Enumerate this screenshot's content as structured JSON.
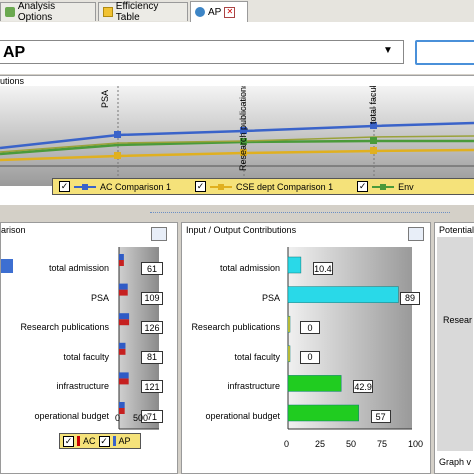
{
  "tabs": [
    {
      "label": "Analysis Options",
      "active": false
    },
    {
      "label": "Efficiency Table",
      "active": false
    },
    {
      "label": "AP",
      "active": true,
      "closable": true
    }
  ],
  "unit_select": {
    "value": "AP"
  },
  "contributions_panel": {
    "title": "utions",
    "point_labels": [
      "PSA",
      "Research publications",
      "total faculty"
    ],
    "legend": [
      {
        "label": "AC Comparison 1",
        "checked": true,
        "color": "#3a63c9"
      },
      {
        "label": "CSE dept Comparison 1",
        "checked": true,
        "color": "#e0b020"
      },
      {
        "label": "Env",
        "checked": true,
        "color": "#4a9a3a"
      }
    ]
  },
  "comparison_panel": {
    "title": "arison",
    "categories": [
      "total admission",
      "PSA",
      "Research publications",
      "total faculty",
      "infrastructure",
      "operational budget"
    ],
    "value_labels": [
      "61",
      "109",
      "126",
      "81",
      "121",
      "71"
    ],
    "axis_ticks": [
      "0",
      "500"
    ],
    "legend": [
      {
        "label": "AC",
        "checked": true
      },
      {
        "label": "AP",
        "checked": true
      }
    ]
  },
  "io_panel": {
    "title": "Input / Output Contributions",
    "categories": [
      "total admission",
      "PSA",
      "Research publications",
      "total faculty",
      "infrastructure",
      "operational budget"
    ],
    "value_labels": [
      "10.4",
      "89",
      "0",
      "0",
      "42.9",
      "57"
    ],
    "axis_ticks": [
      "0",
      "25",
      "50",
      "75",
      "100"
    ]
  },
  "potential_panel": {
    "title": "Potential",
    "row_label": "Resear",
    "footer": "Graph v"
  },
  "chart_data": [
    {
      "type": "bar",
      "title": "Input / Output Contributions",
      "categories": [
        "total admission",
        "PSA",
        "Research publications",
        "total faculty",
        "infrastructure",
        "operational budget"
      ],
      "values": [
        10.4,
        89,
        0,
        0,
        42.9,
        57
      ],
      "xlim": [
        0,
        100
      ],
      "orientation": "horizontal"
    },
    {
      "type": "bar",
      "categories": [
        "total admission",
        "PSA",
        "Research publications",
        "total faculty",
        "infrastructure",
        "operational budget"
      ],
      "values": [
        61,
        109,
        126,
        81,
        121,
        71
      ],
      "xlim": [
        0,
        500
      ],
      "orientation": "horizontal"
    }
  ]
}
